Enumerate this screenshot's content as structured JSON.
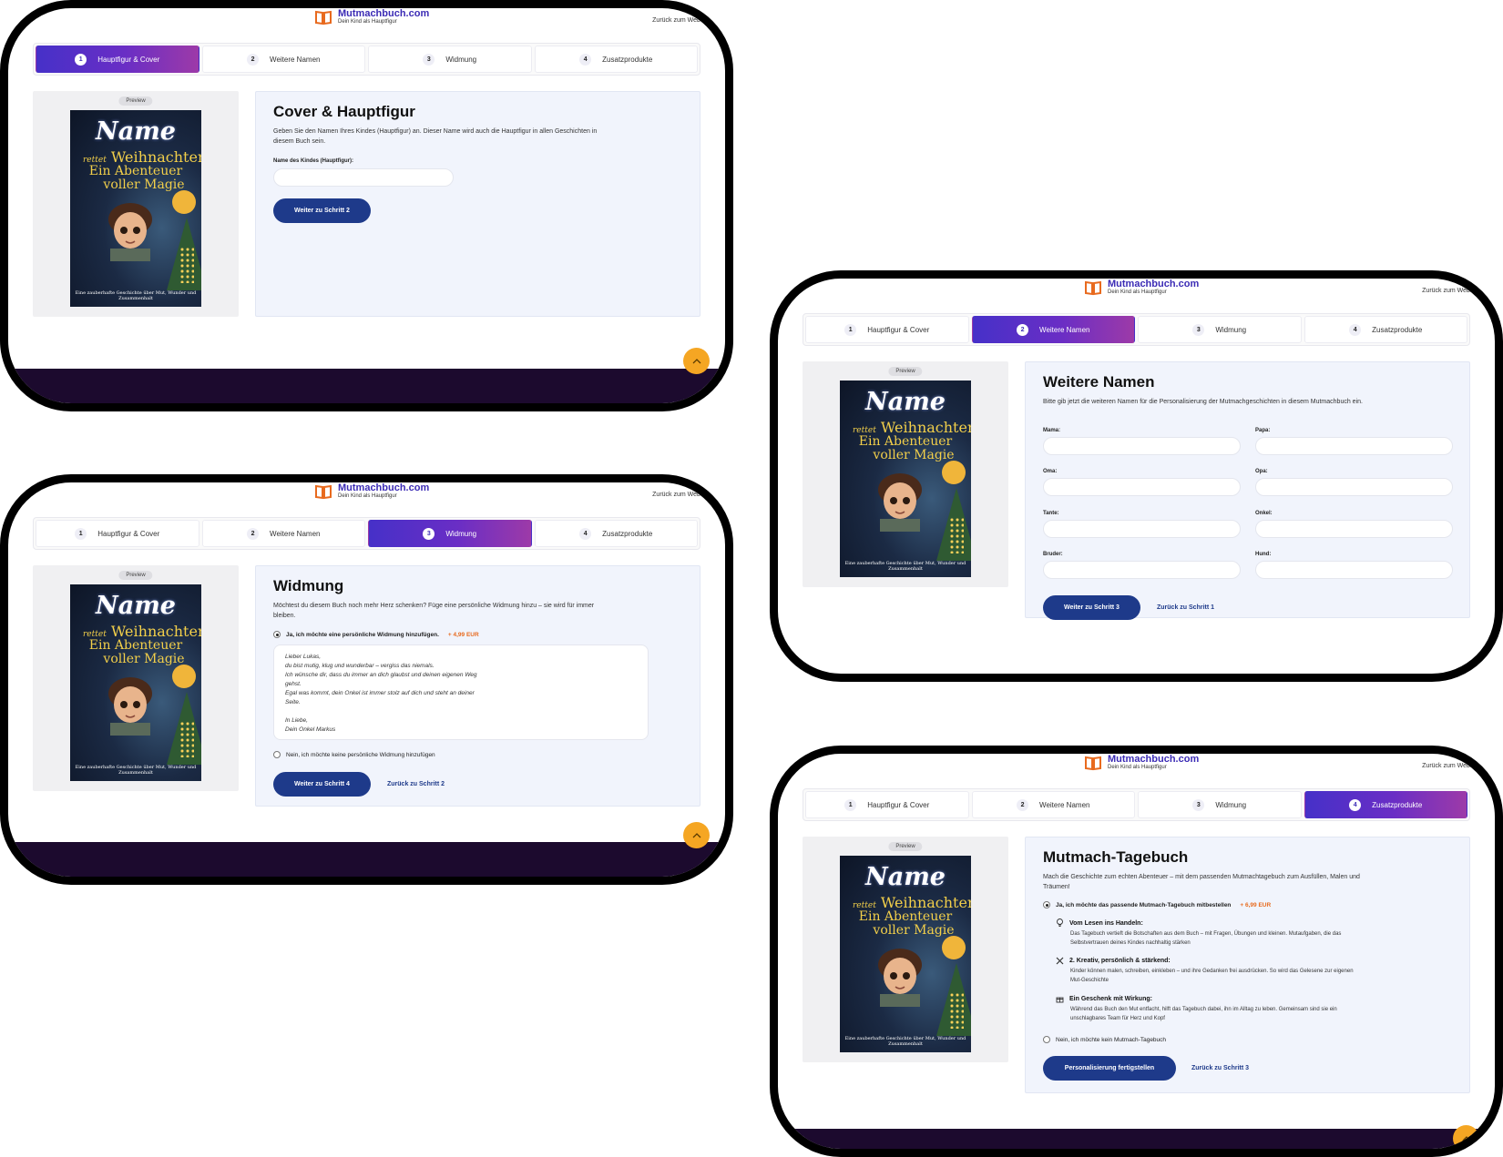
{
  "brand": {
    "name": "Mutmachbuch.com",
    "tagline": "Dein Kind als Hauptfigur",
    "back_link": "Zurück zum Websi"
  },
  "steps": [
    {
      "num": "1",
      "label": "Hauptfigur & Cover"
    },
    {
      "num": "2",
      "label": "Weitere Namen"
    },
    {
      "num": "3",
      "label": "Widmung"
    },
    {
      "num": "4",
      "label": "Zusatzprodukte"
    }
  ],
  "preview": {
    "tag": "Preview",
    "cover": {
      "name": "Name",
      "line1_small": "rettet",
      "line1": "Weihnachten",
      "line2": "Ein Abenteuer",
      "line3": "voller Magie",
      "subtitle": "Eine zauberhafte Geschichte über Mut, Wunder und Zusammenhalt"
    }
  },
  "screen1": {
    "title": "Cover & Hauptfigur",
    "description": "Geben Sie den Namen Ihres Kindes (Hauptfigur) an. Dieser Name wird auch die Hauptfigur in allen Geschichten in diesem Buch sein.",
    "field_label": "Name des Kindes (Hauptfigur):",
    "field_value": "",
    "next_button": "Weiter zu Schritt 2"
  },
  "screen2": {
    "title": "Weitere Namen",
    "description": "Bitte gib jetzt die weiteren Namen für die Personalisierung der Mutmachgeschichten in diesem Mutmachbuch ein.",
    "fields": [
      {
        "label": "Mama:",
        "value": ""
      },
      {
        "label": "Papa:",
        "value": ""
      },
      {
        "label": "Oma:",
        "value": ""
      },
      {
        "label": "Opa:",
        "value": ""
      },
      {
        "label": "Tante:",
        "value": ""
      },
      {
        "label": "Onkel:",
        "value": ""
      },
      {
        "label": "Bruder:",
        "value": ""
      },
      {
        "label": "Hund:",
        "value": ""
      }
    ],
    "next_button": "Weiter zu Schritt 3",
    "back_link": "Zurück zu Schritt 1"
  },
  "screen3": {
    "title": "Widmung",
    "description": "Möchtest du diesem Buch noch mehr Herz schenken? Füge eine persönliche Widmung hinzu – sie wird für immer bleiben.",
    "option_yes": "Ja, ich möchte eine persönliche Widmung hinzufügen.",
    "option_yes_price": "+ 4,99 EUR",
    "dedication_text": "Lieber Lukas,\ndu bist mutig, klug und wunderbar – vergiss das niemals.\nIch wünsche dir, dass du immer an dich glaubst und deinen eigenen Weg\ngehst.\nEgal was kommt, dein Onkel ist immer stolz auf dich und steht an deiner\nSeite.\n\nIn Liebe,\nDein Onkel Markus",
    "option_no": "Nein, ich möchte keine persönliche Widmung hinzufügen",
    "next_button": "Weiter zu Schritt 4",
    "back_link": "Zurück zu Schritt 2"
  },
  "screen4": {
    "title": "Mutmach-Tagebuch",
    "description": "Mach die Geschichte zum echten Abenteuer – mit dem passenden Mutmachtagebuch zum Ausfüllen, Malen und Träumen!",
    "option_yes": "Ja, ich möchte das passende Mutmach-Tagebuch mitbestellen",
    "option_yes_price": "+ 6,99 EUR",
    "features": [
      {
        "icon": "lightbulb-icon",
        "title": "Vom Lesen ins Handeln:",
        "text": "Das Tagebuch vertieft die Botschaften aus dem Buch – mit Fragen, Übungen und kleinen. Mutaufgaben, die das Selbstvertrauen deines Kindes nachhaltig stärken"
      },
      {
        "icon": "tools-icon",
        "title": "2. Kreativ, persönlich & stärkend:",
        "text": "Kinder können malen, schreiben, einkleben – und ihre Gedanken frei ausdrücken. So wird das Gelesene zur eigenen Mut-Geschichte"
      },
      {
        "icon": "gift-icon",
        "title": "Ein Geschenk mit Wirkung:",
        "text": "Während das Buch den Mut entfacht, hilft das Tagebuch dabei, ihn im Alltag zu leben. Gemeinsam sind sie ein unschlagbares Team für Herz und Kopf"
      }
    ],
    "option_no": "Nein, ich möchte kein Mutmach-Tagebuch",
    "finish_button": "Personalisierung fertigstellen",
    "back_link": "Zurück zu Schritt 3"
  },
  "colors": {
    "accent": "#1e3a8a",
    "step_active_start": "#4630c8",
    "step_active_end": "#9d3aa8",
    "price": "#e86a1e",
    "scroll_top": "#f5a623",
    "footer": "#1c0a2e"
  }
}
